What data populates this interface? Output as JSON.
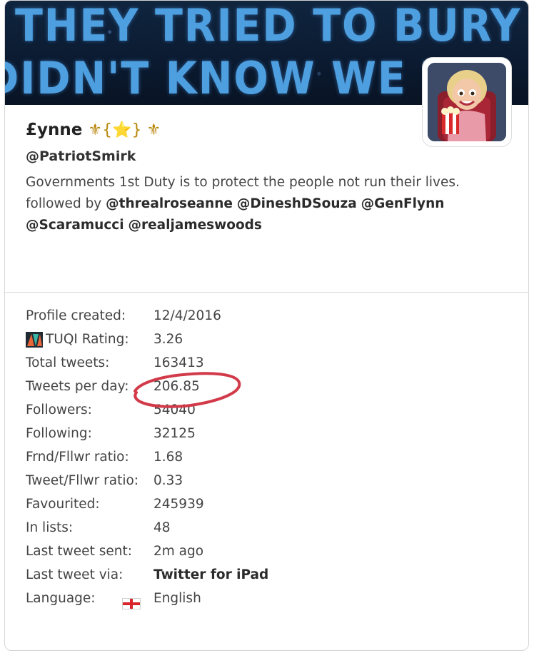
{
  "banner": {
    "line1": "THEY TRIED TO BURY US.",
    "line2": "DIDN'T KNOW WE WE"
  },
  "profile": {
    "name": "£ynne",
    "name_decoration": "⚜{⭐} ⚜",
    "handle": "@PatriotSmirk",
    "bio_text": "Governments 1st Duty is to protect the people not run their lives.",
    "bio_followed_prefix": "followed by",
    "followed_by": [
      "@threalroseanne",
      "@DineshDSouza",
      "@GenFlynn",
      "@Scaramucci",
      "@realjameswoods"
    ]
  },
  "stats": [
    {
      "label": "Profile created:",
      "value": "12/4/2016"
    },
    {
      "label": "TUQI Rating:",
      "value": "3.26",
      "icon": "tuqi-logo-icon"
    },
    {
      "label": "Total tweets:",
      "value": "163413"
    },
    {
      "label": "Tweets per day:",
      "value": "206.85",
      "annotated": true
    },
    {
      "label": "Followers:",
      "value": "54040"
    },
    {
      "label": "Following:",
      "value": "32125"
    },
    {
      "label": "Frnd/Fllwr ratio:",
      "value": "1.68"
    },
    {
      "label": "Tweet/Fllwr ratio:",
      "value": "0.33"
    },
    {
      "label": "Favourited:",
      "value": "245939"
    },
    {
      "label": "In lists:",
      "value": "48"
    },
    {
      "label": "Last tweet sent:",
      "value": "2m ago"
    },
    {
      "label": "Last tweet via:",
      "value": "Twitter for iPad",
      "bold": true
    },
    {
      "label": "Language:",
      "value": "English",
      "icon": "england-flag-icon"
    }
  ],
  "colors": {
    "annotation": "#d23a4a",
    "banner_text": "#4e9fe0"
  }
}
